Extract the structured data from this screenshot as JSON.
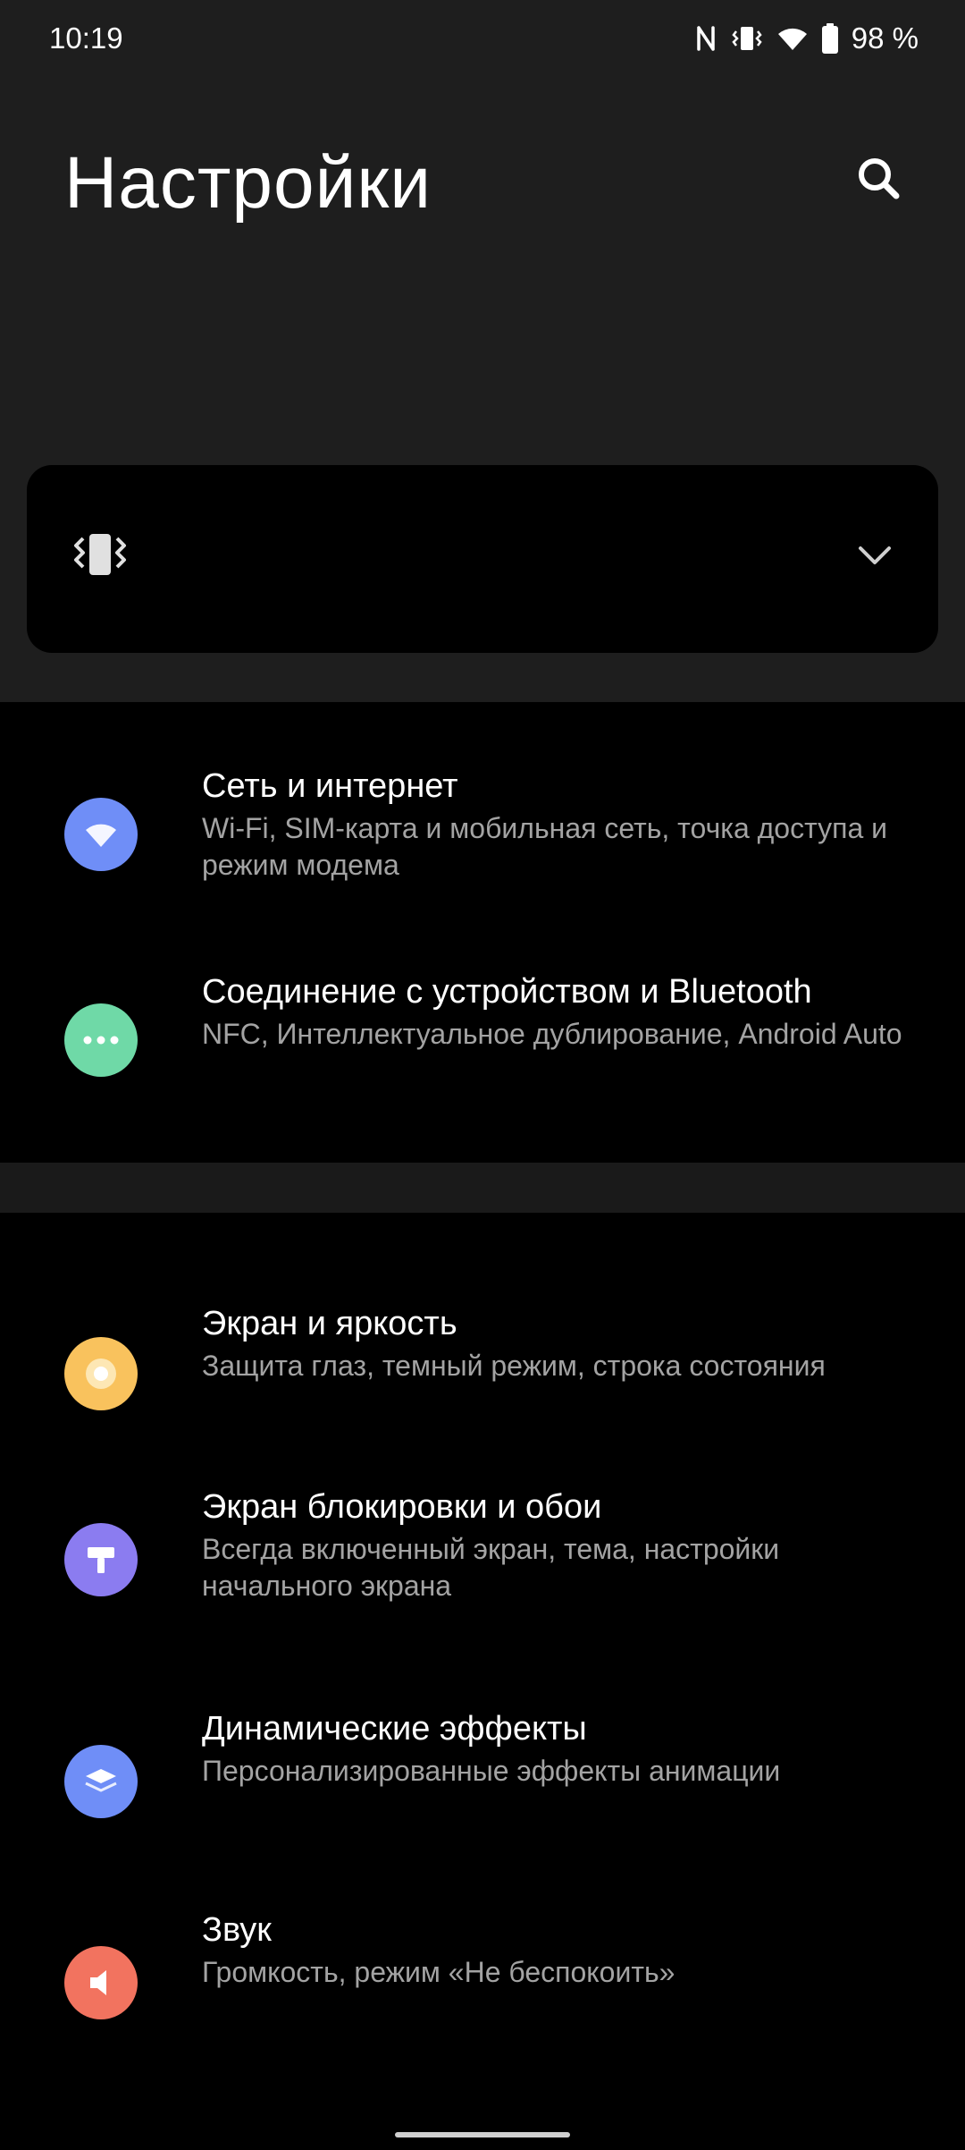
{
  "status_bar": {
    "time": "10:19",
    "battery": "98 %",
    "icons": [
      "nfc-icon",
      "vibrate-icon",
      "wifi-icon",
      "battery-icon"
    ]
  },
  "header": {
    "title": "Настройки",
    "search_icon": "search-icon"
  },
  "sound_card": {
    "mode_icon": "vibrate-icon",
    "expand_icon": "chevron-down-icon"
  },
  "section_connectivity": [
    {
      "title": "Сеть и интернет",
      "subtitle": "Wi-Fi, SIM-карта и мобильная сеть, точка доступа и режим модема",
      "icon": "wifi-icon",
      "color": "#6f8ef7"
    },
    {
      "title": "Соединение с устройством и Bluetooth",
      "subtitle": "NFC, Интеллектуальное дублирование, Android Auto",
      "icon": "dots-icon",
      "color": "#6fd9a7"
    }
  ],
  "section_personal": [
    {
      "title": "Экран и яркость",
      "subtitle": "Защита глаз, темный режим, строка состояния",
      "icon": "brightness-icon",
      "color": "#f9c25d"
    },
    {
      "title": "Экран блокировки и обои",
      "subtitle": "Всегда включенный экран, тема, настройки начального экрана",
      "icon": "paint-roller-icon",
      "color": "#8b7cf0"
    },
    {
      "title": "Динамические эффекты",
      "subtitle": "Персонализированные эффекты анимации",
      "icon": "layers-icon",
      "color": "#6f8ef7"
    },
    {
      "title": "Звук",
      "subtitle": "Громкость, режим «Не беспокоить»",
      "icon": "speaker-icon",
      "color": "#f2735f"
    }
  ]
}
